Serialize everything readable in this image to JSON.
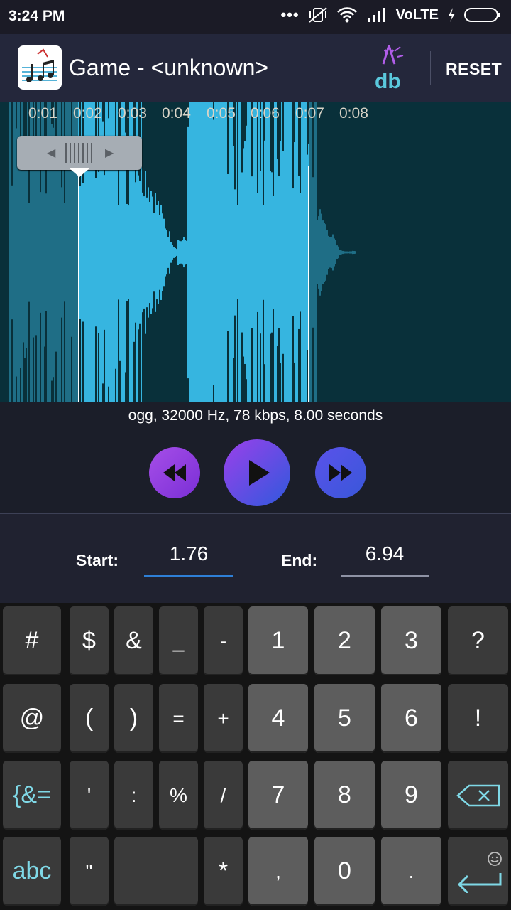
{
  "status_bar": {
    "time": "3:24 PM",
    "dots": "•••",
    "network": "VoLTE"
  },
  "app_bar": {
    "title": "Game - <unknown>",
    "reset_label": "RESET"
  },
  "waveform": {
    "time_ticks": [
      "0:01",
      "0:02",
      "0:03",
      "0:04",
      "0:05",
      "0:06",
      "0:07",
      "0:08"
    ]
  },
  "audio_info": "ogg, 32000 Hz, 78 kbps, 8.00 seconds",
  "fields": {
    "start_label": "Start:",
    "start_value": "1.76",
    "end_label": "End:",
    "end_value": "6.94"
  },
  "keyboard": {
    "rows": [
      [
        "#",
        "$",
        "&",
        "_",
        "-",
        "1",
        "2",
        "3",
        "?"
      ],
      [
        "@",
        "(",
        ")",
        "=",
        "+",
        "4",
        "5",
        "6",
        "!"
      ],
      [
        "{&=",
        "'",
        ":",
        "%",
        "/",
        "7",
        "8",
        "9",
        ""
      ],
      [
        "abc",
        "\"",
        "",
        "*",
        ",",
        "0",
        ".",
        ""
      ]
    ]
  },
  "colors": {
    "accent": "#2e7fd6",
    "waveform": "#36b5e0",
    "app_bar": "#24273b"
  }
}
